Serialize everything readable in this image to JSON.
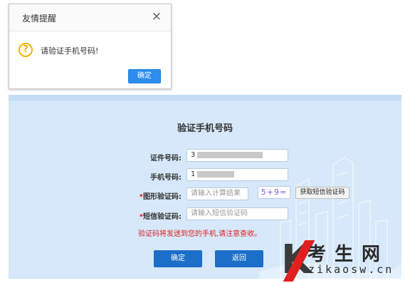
{
  "dialog": {
    "title": "友情提醒",
    "close_glyph": "×",
    "icon": "question-icon",
    "icon_glyph": "?",
    "message": "请验证手机号码!",
    "ok_label": "确定"
  },
  "verify": {
    "title": "验证手机号码",
    "id_label": "证件号码:",
    "id_value": "3",
    "phone_label": "手机号码:",
    "phone_value": "1",
    "captcha_star": "*",
    "captcha_label": "图形验证码:",
    "captcha_placeholder": "请输入计算结果",
    "captcha_text": "5+9=",
    "sms_button": "获取短信验证码",
    "sms_star": "*",
    "sms_label": "短信验证码:",
    "sms_placeholder": "请输入短信验证码",
    "notice": "验证码将发送到您的手机,请注意查收。",
    "confirm_label": "确定",
    "back_label": "返回"
  },
  "watermark": {
    "brand": "考生网",
    "url": "zikaosw.cn"
  },
  "colors": {
    "primary": "#1c6fc9",
    "dialog_button": "#2e8ded",
    "warning": "#f0b400",
    "error_text": "#e02020",
    "panel_bg": "#d6e8f9"
  }
}
